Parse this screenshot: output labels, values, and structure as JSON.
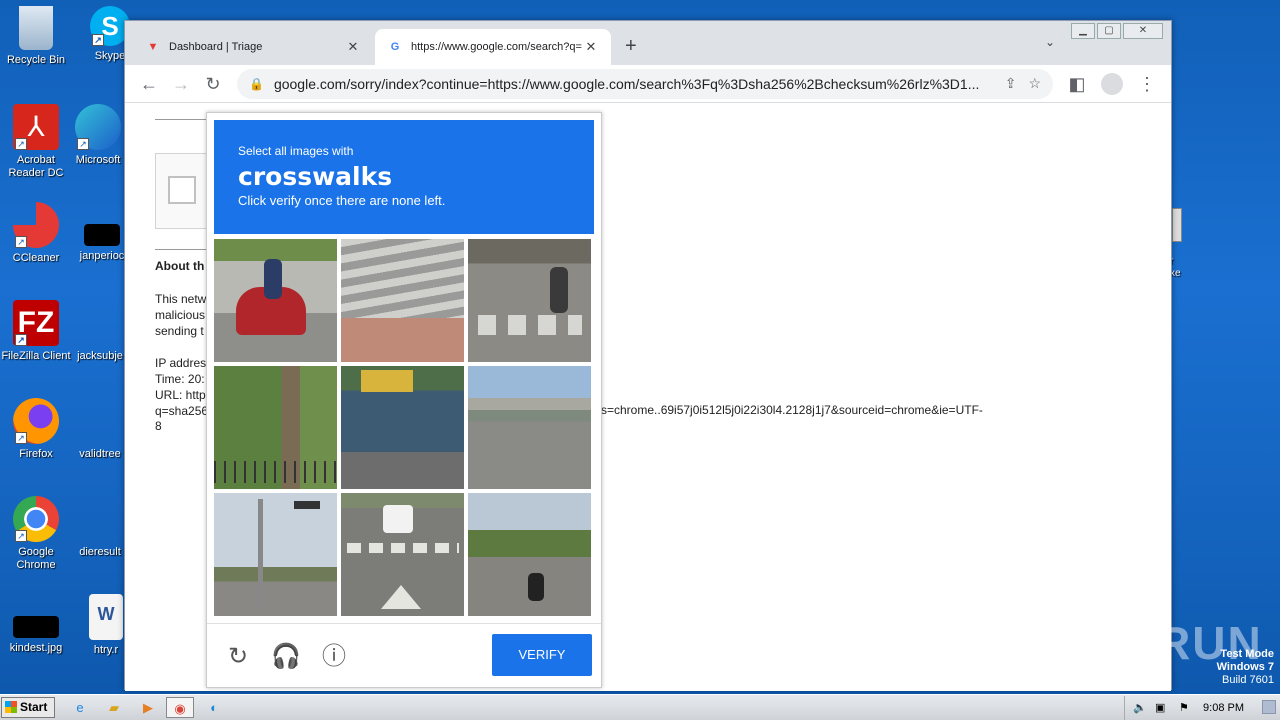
{
  "desktop": {
    "icons": [
      {
        "label": "Recycle Bin"
      },
      {
        "label": "Skype"
      },
      {
        "label": "Acrobat Reader DC"
      },
      {
        "label": "Microsoft"
      },
      {
        "label": "CCleaner"
      },
      {
        "label": "janperioc"
      },
      {
        "label": "FileZilla Client"
      },
      {
        "label": "jacksubje"
      },
      {
        "label": "Firefox"
      },
      {
        "label": "validtree"
      },
      {
        "label": "Google Chrome"
      },
      {
        "label": "dieresult"
      },
      {
        "label": "kindest.jpg"
      },
      {
        "label": "htry.r"
      }
    ],
    "side_text": "r\nxe",
    "watermark": "ANY RUN",
    "testmode": {
      "line1": "Test Mode",
      "line2": "Windows 7",
      "line3": "Build 7601"
    }
  },
  "browser": {
    "tabs": [
      {
        "title": "Dashboard | Triage",
        "close": "✕"
      },
      {
        "title": "https://www.google.com/search?q=",
        "close": "✕"
      }
    ],
    "new_tab": "+",
    "url": "google.com/sorry/index?continue=https://www.google.com/search%3Fq%3Dsha256%2Bchecksum%26rlz%3D1..."
  },
  "page": {
    "about_heading": "About th",
    "para1": "This netw\nmalicious\nsending t",
    "para2": "IP addres\nTime: 20:\nURL: http\nq=sha256",
    "url_tail": "s=chrome..69i57j0i512l5j0i22i30l4.2128j1j7&sourceid=chrome&ie=UTF-",
    "url_tail2": "8"
  },
  "captcha": {
    "instruction": "Select all images with",
    "target": "crosswalks",
    "hint": "Click verify once there are none left.",
    "verify_label": "VERIFY"
  },
  "taskbar": {
    "start_label": "Start",
    "clock": "9:08 PM"
  }
}
